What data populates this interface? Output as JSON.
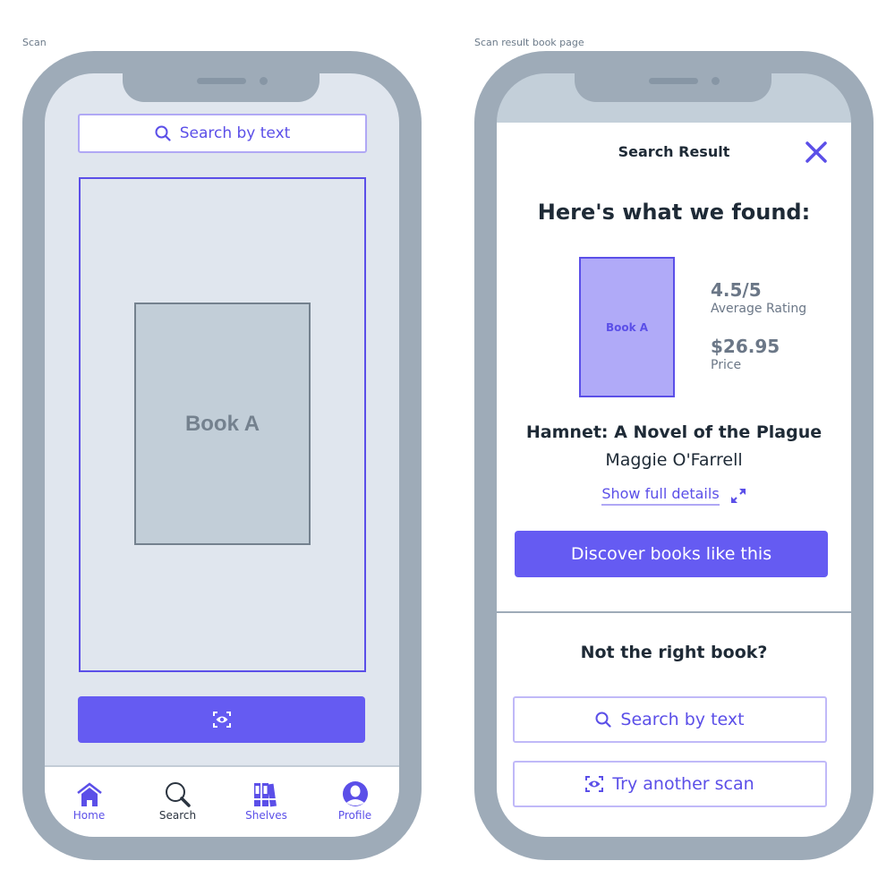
{
  "frames": [
    {
      "label": "Scan"
    },
    {
      "label": "Scan result book page"
    }
  ],
  "scan_screen": {
    "search_button": {
      "label": "Search by text",
      "icon": "search-icon"
    },
    "viewfinder_book_label": "Book A",
    "scan_button": {
      "icon": "scan-eye-icon"
    },
    "tab_bar": [
      {
        "label": "Home",
        "icon": "home-icon",
        "active": false
      },
      {
        "label": "Search",
        "icon": "search-icon",
        "active": true
      },
      {
        "label": "Shelves",
        "icon": "shelves-icon",
        "active": false
      },
      {
        "label": "Profile",
        "icon": "profile-icon",
        "active": false
      }
    ]
  },
  "result_screen": {
    "title": "Search Result",
    "close_icon": "close-icon",
    "heading": "Here's what we found:",
    "cover_label": "Book A",
    "rating": {
      "value": "4.5/5",
      "label": "Average Rating"
    },
    "price": {
      "value": "$26.95",
      "label": "Price"
    },
    "book_title": "Hamnet: A Novel of the Plague",
    "book_author": "Maggie O'Farrell",
    "details_link": {
      "label": "Show full details",
      "icon": "expand-icon"
    },
    "discover_button": "Discover books like this",
    "not_right_heading": "Not the right book?",
    "search_button": {
      "label": "Search by text",
      "icon": "search-icon"
    },
    "scan_again_button": {
      "label": "Try another scan",
      "icon": "scan-eye-icon"
    }
  },
  "colors": {
    "accent": "#655bf2",
    "accent_light": "#b0aaf8",
    "device": "#9eabb8",
    "screen_bg": "#e0e6ee",
    "text_dark": "#1e2a36",
    "text_muted": "#6b7787"
  }
}
